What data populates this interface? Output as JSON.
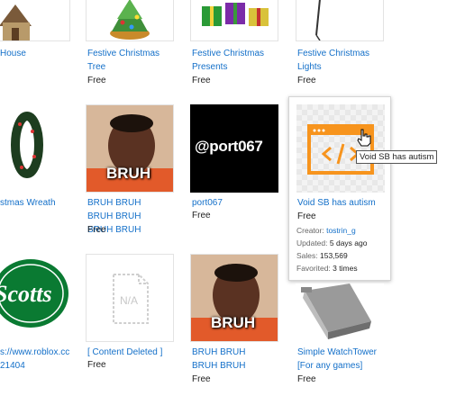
{
  "row1": [
    {
      "name": "House",
      "price": ""
    },
    {
      "name": "Festive Christmas Tree",
      "price": "Free"
    },
    {
      "name": "Festive Christmas Presents",
      "price": "Free"
    },
    {
      "name": "Festive Christmas Lights",
      "price": "Free"
    }
  ],
  "row2": [
    {
      "name": "stmas Wreath",
      "price": ""
    },
    {
      "name": "BRUH BRUH BRUH BRUH BRUH BRUH",
      "price": "Free"
    },
    {
      "name": "port067",
      "price": "Free"
    },
    {
      "name": "Void SB has autism",
      "price": "Free"
    }
  ],
  "row3": [
    {
      "name": "s://www.roblox.cc 21404",
      "price": ""
    },
    {
      "name": "[ Content Deleted ]",
      "price": "Free"
    },
    {
      "name": "BRUH BRUH BRUH BRUH",
      "price": "Free"
    },
    {
      "name": "Simple WatchTower [For any games]",
      "price": "Free"
    }
  ],
  "thumb_text": {
    "bruh": "BRUH",
    "port067": "@port067",
    "scotts": "Scotts",
    "na": "N/A"
  },
  "hover_details": {
    "creator_label": "Creator:",
    "creator_value": "tostrin_g",
    "updated_label": "Updated:",
    "updated_value": "5 days ago",
    "sales_label": "Sales:",
    "sales_value": "153,569",
    "favorited_label": "Favorited:",
    "favorited_value": "3 times"
  },
  "tooltip": "Void SB has autism",
  "colors": {
    "link": "#1470c9",
    "code_icon_orange": "#f7941d",
    "scotts_green": "#0a7a32"
  }
}
